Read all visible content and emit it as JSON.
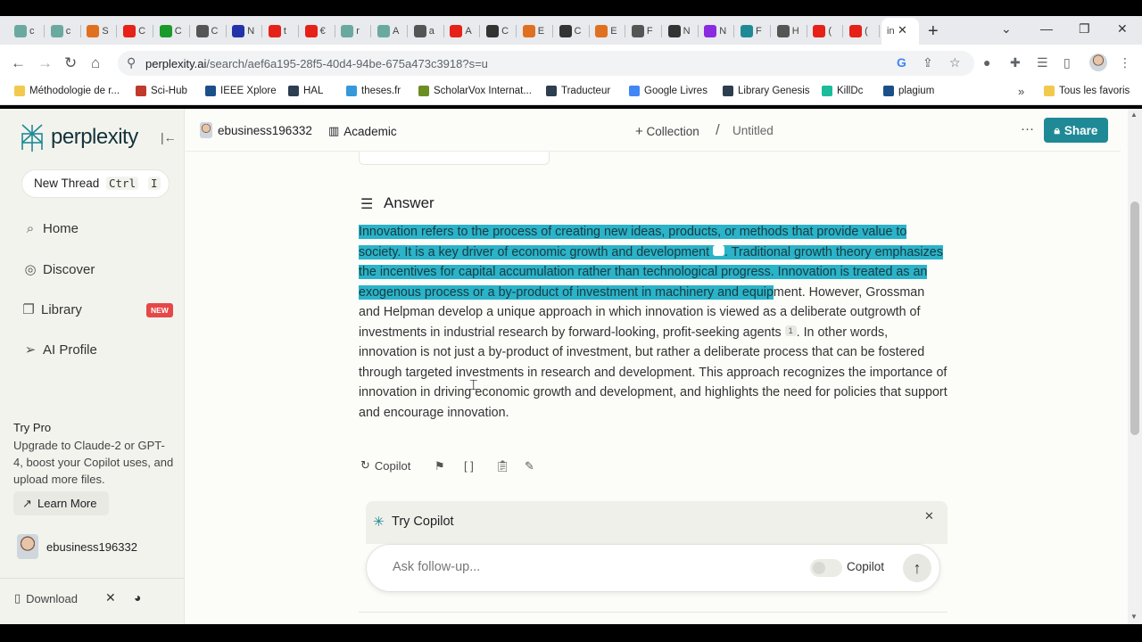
{
  "browser": {
    "tabs": [
      {
        "label": "c",
        "color": "#6aa9a0"
      },
      {
        "label": "c",
        "color": "#6aa9a0"
      },
      {
        "label": "S",
        "color": "#e07020"
      },
      {
        "label": "C",
        "color": "#e62117"
      },
      {
        "label": "C",
        "color": "#1a9a2a"
      },
      {
        "label": "C",
        "color": "#555555"
      },
      {
        "label": "N",
        "color": "#2233aa"
      },
      {
        "label": "t",
        "color": "#e62117"
      },
      {
        "label": "€",
        "color": "#e62117"
      },
      {
        "label": "r",
        "color": "#6aa9a0"
      },
      {
        "label": "A",
        "color": "#6aa9a0"
      },
      {
        "label": "a",
        "color": "#555555"
      },
      {
        "label": "A",
        "color": "#e62117"
      },
      {
        "label": "C",
        "color": "#333333"
      },
      {
        "label": "E",
        "color": "#e07020"
      },
      {
        "label": "C",
        "color": "#333333"
      },
      {
        "label": "E",
        "color": "#e07020"
      },
      {
        "label": "F",
        "color": "#555555"
      },
      {
        "label": "N",
        "color": "#333333"
      },
      {
        "label": "N",
        "color": "#8a2be2"
      },
      {
        "label": "F",
        "color": "#1f8a96"
      },
      {
        "label": "H",
        "color": "#555555"
      },
      {
        "label": "(",
        "color": "#e62117"
      },
      {
        "label": "(",
        "color": "#e62117"
      }
    ],
    "active_tab": "in",
    "url_host": "perplexity.ai",
    "url_path": "/search/aef6a195-28f5-40d4-94be-675a473c3918?s=u",
    "bookmarks": [
      {
        "label": "Méthodologie de r...",
        "color": "#f2c94c"
      },
      {
        "label": "Sci-Hub",
        "color": "#c0392b"
      },
      {
        "label": "IEEE Xplore",
        "color": "#1b4f8a"
      },
      {
        "label": "HAL",
        "color": "#2c3e50"
      },
      {
        "label": "theses.fr",
        "color": "#3498db"
      },
      {
        "label": "ScholarVox Internat...",
        "color": "#6b8e23"
      },
      {
        "label": "Traducteur",
        "color": "#2c3e50"
      },
      {
        "label": "Google Livres",
        "color": "#4285f4"
      },
      {
        "label": "Library Genesis",
        "color": "#2c3e50"
      },
      {
        "label": "KillDc",
        "color": "#1abc9c"
      },
      {
        "label": "plagium",
        "color": "#1b4f8a"
      }
    ],
    "all_bookmarks": "Tous les favoris"
  },
  "sidebar": {
    "brand": "perplexity",
    "new_thread": "New Thread",
    "shortcut_keys": [
      "Ctrl",
      "I"
    ],
    "items": [
      {
        "label": "Home",
        "icon": "search-icon",
        "glyph": "⌕"
      },
      {
        "label": "Discover",
        "icon": "compass-icon",
        "glyph": "◎"
      },
      {
        "label": "Library",
        "icon": "library-icon",
        "glyph": "❐"
      },
      {
        "label": "AI Profile",
        "icon": "send-icon",
        "glyph": "➢"
      }
    ],
    "new_badge": "NEW",
    "try_pro_title": "Try Pro",
    "try_pro_desc": "Upgrade to Claude-2 or GPT-4, boost your Copilot uses, and upload more files.",
    "learn_more": "Learn More",
    "username": "ebusiness196332",
    "download": "Download"
  },
  "header": {
    "username": "ebusiness196332",
    "focus": "Academic",
    "collection": "Collection",
    "slash": "/",
    "thread_title": "Untitled",
    "share": "Share"
  },
  "answer": {
    "title": "Answer",
    "highlighted_1": "Innovation refers to the process of creating new ideas, products, or methods that provide value to society. It is a key driver of economic growth and development",
    "citation_1": "1",
    "highlighted_2": ". Traditional growth theory emphasizes the incentives for capital accumulation rather than technological progress. Innovation is treated as an exogenous process or a by-product of investment in machinery and equip",
    "plain_1": "ment. However, Grossman and Helpman develop a unique approach in which innovation is viewed as a deliberate outgrowth of investments in industrial research by forward-looking, profit-seeking agents",
    "citation_2": "1",
    "plain_2": ". In other words, innovation is not just a by-product of investment, but rather a deliberate process that can be fostered through targeted investments in research and development. This approach recognizes the importance of innovation in driving economic growth and development, and highlights the need for policies that support and encourage innovation."
  },
  "actions": {
    "copilot": "Copilot"
  },
  "copilot_panel": {
    "title": "Try Copilot",
    "placeholder": "Ask follow-up...",
    "toggle_label": "Copilot"
  },
  "colors": {
    "accent": "#1f8a96",
    "highlight": "#2ab3c9",
    "badge": "#e54848"
  }
}
